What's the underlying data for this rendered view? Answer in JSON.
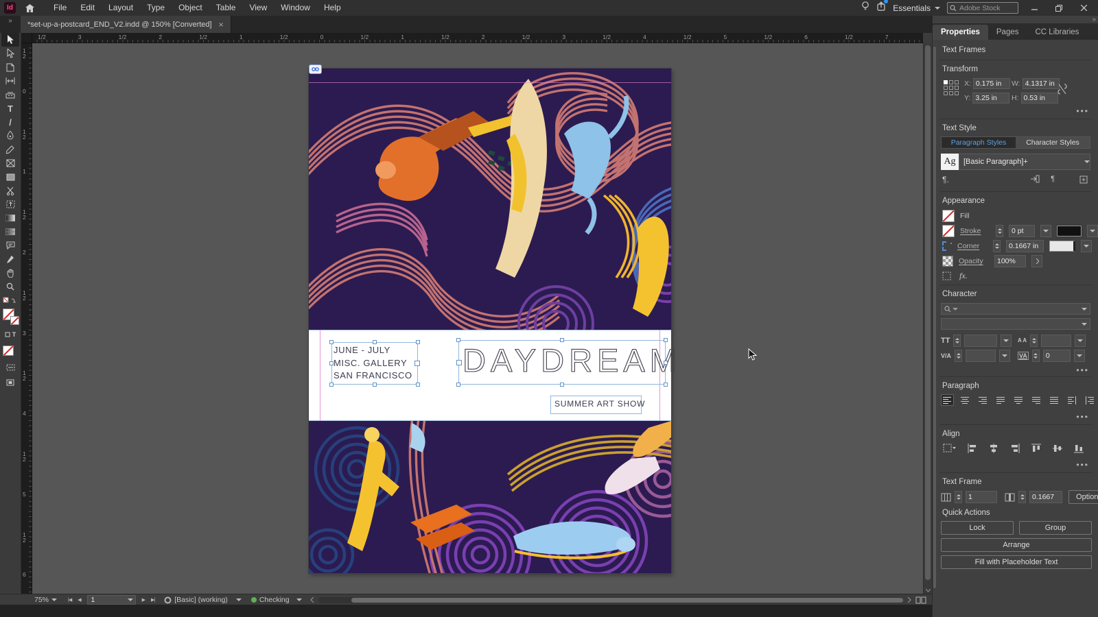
{
  "menubar": {
    "app_icon": "Id",
    "menus": [
      "File",
      "Edit",
      "Layout",
      "Type",
      "Object",
      "Table",
      "View",
      "Window",
      "Help"
    ],
    "workspace": "Essentials",
    "search_placeholder": "Adobe Stock"
  },
  "tabbar": {
    "doc_title": "*set-up-a-postcard_END_V2.indd @ 150% [Converted]",
    "close": "×",
    "overflow": "»"
  },
  "rulers": {
    "horizontal": [
      "1/2",
      "3",
      "1/2",
      "2",
      "1/2",
      "1",
      "1/2",
      "0",
      "1/2",
      "1",
      "1/2",
      "2",
      "1/2",
      "3",
      "1/2",
      "4",
      "1/2",
      "5",
      "1/2",
      "6",
      "1/2",
      "7"
    ],
    "vertical": [
      "1/2",
      "0",
      "1/2",
      "1",
      "1/2",
      "2",
      "1/2",
      "3",
      "1/2",
      "4",
      "1/2",
      "5",
      "1/2",
      "6"
    ]
  },
  "page": {
    "texts": {
      "schedule_line1": "JUNE - JULY",
      "schedule_line2": "MISC. GALLERY",
      "schedule_line3": "SAN FRANCISCO",
      "title": "DAYDREAM",
      "subtitle": "SUMMER ART SHOW"
    }
  },
  "panel": {
    "tabs": {
      "properties": "Properties",
      "pages": "Pages",
      "cc_libraries": "CC Libraries"
    },
    "frames_label": "Text Frames",
    "transform": {
      "title": "Transform",
      "x_label": "X:",
      "x_value": "0.175 in",
      "y_label": "Y:",
      "y_value": "3.25 in",
      "w_label": "W:",
      "w_value": "4.1317 in",
      "h_label": "H:",
      "h_value": "0.53 in"
    },
    "text_style": {
      "title": "Text Style",
      "paragraph_tab": "Paragraph Styles",
      "character_tab": "Character Styles",
      "sample": "Ag",
      "style_name": "[Basic Paragraph]+"
    },
    "appearance": {
      "title": "Appearance",
      "fill": "Fill",
      "stroke": "Stroke",
      "stroke_weight": "0 pt",
      "corner": "Corner",
      "corner_radius": "0.1667 in",
      "opacity": "Opacity",
      "opacity_value": "100%",
      "fx": "fx."
    },
    "character": {
      "title": "Character",
      "tracking_value": "0"
    },
    "paragraph": {
      "title": "Paragraph"
    },
    "align": {
      "title": "Align"
    },
    "text_frame": {
      "title": "Text Frame",
      "columns_value": "1",
      "inset_value": "0.1667",
      "options": "Options"
    },
    "quick_actions": {
      "title": "Quick Actions",
      "lock": "Lock",
      "group": "Group",
      "arrange": "Arrange",
      "fill_placeholder": "Fill with Placeholder Text"
    }
  },
  "glyphs": {
    "para_mark": "¶",
    "para_mark_dot": "¶.",
    "fx": "fx.",
    "font_size": "TT",
    "leading": "A A",
    "kerning": "V/A",
    "tracking": "VA",
    "type_tool": "T",
    "line_tool": "/"
  },
  "statusbar": {
    "zoom_level": "75%",
    "page": "1",
    "preset": "[Basic] (working)",
    "status": "Checking"
  },
  "colors": {
    "accent_blue": "#5ea0e0",
    "selection_blue": "#5f93c8",
    "guide_pink": "#e382d0",
    "art_bg": "#2b1b50",
    "art_salmon": "#c4726f",
    "art_purple": "#7a3fb0",
    "art_navy": "#27407c",
    "art_orange": "#e2702a",
    "art_yellow": "#f5c22f",
    "art_blue": "#8fc2e8",
    "status_green": "#61b052"
  }
}
